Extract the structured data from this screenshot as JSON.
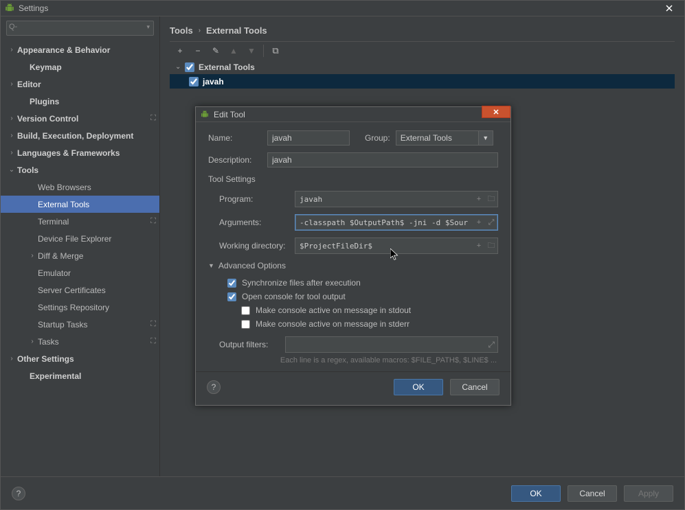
{
  "window": {
    "title": "Settings"
  },
  "search": {
    "placeholder": "",
    "prefix": "Q-"
  },
  "sidebar": {
    "items": [
      {
        "label": "Appearance & Behavior",
        "chev": "›",
        "bold": true
      },
      {
        "label": "Keymap",
        "bold": true,
        "ind": 1,
        "chev": ""
      },
      {
        "label": "Editor",
        "chev": "›",
        "bold": true
      },
      {
        "label": "Plugins",
        "bold": true,
        "ind": 1,
        "chev": ""
      },
      {
        "label": "Version Control",
        "chev": "›",
        "bold": true,
        "icon": "⛶"
      },
      {
        "label": "Build, Execution, Deployment",
        "chev": "›",
        "bold": true
      },
      {
        "label": "Languages & Frameworks",
        "chev": "›",
        "bold": true
      },
      {
        "label": "Tools",
        "chev": "⌄",
        "bold": true
      },
      {
        "label": "Web Browsers",
        "ind": 2
      },
      {
        "label": "External Tools",
        "ind": 2,
        "sel": true
      },
      {
        "label": "Terminal",
        "ind": 2,
        "icon": "⛶"
      },
      {
        "label": "Device File Explorer",
        "ind": 2
      },
      {
        "label": "Diff & Merge",
        "ind": 2,
        "chev": "›"
      },
      {
        "label": "Emulator",
        "ind": 2
      },
      {
        "label": "Server Certificates",
        "ind": 2
      },
      {
        "label": "Settings Repository",
        "ind": 2
      },
      {
        "label": "Startup Tasks",
        "ind": 2,
        "icon": "⛶"
      },
      {
        "label": "Tasks",
        "ind": 2,
        "chev": "›",
        "icon": "⛶"
      },
      {
        "label": "Other Settings",
        "chev": "›",
        "bold": true
      },
      {
        "label": "Experimental",
        "bold": true,
        "ind": 1,
        "chev": ""
      }
    ]
  },
  "breadcrumb": {
    "parent": "Tools",
    "sep": "›",
    "current": "External Tools"
  },
  "toolbar": {
    "add": "+",
    "remove": "−",
    "edit": "✎",
    "up": "▲",
    "down": "▼",
    "copy": "⧉"
  },
  "tree": {
    "root": {
      "label": "External Tools",
      "expanded": true,
      "checked": true
    },
    "child": {
      "label": "javah",
      "checked": true
    }
  },
  "dialog": {
    "title": "Edit Tool",
    "name": {
      "label": "Name:",
      "value": "javah"
    },
    "group": {
      "label": "Group:",
      "value": "External Tools"
    },
    "description": {
      "label": "Description:",
      "value": "javah"
    },
    "section_tool_settings": "Tool Settings",
    "program": {
      "label": "Program:",
      "value": "javah"
    },
    "arguments": {
      "label": "Arguments:",
      "value": "-classpath $OutputPath$ -jni -d $Source"
    },
    "workdir": {
      "label": "Working directory:",
      "value": "$ProjectFileDir$"
    },
    "advanced": {
      "label": "Advanced Options",
      "sync": {
        "label": "Synchronize files after execution",
        "checked": true
      },
      "open_console": {
        "label": "Open console for tool output",
        "checked": true
      },
      "stdout": {
        "label": "Make console active on message in stdout",
        "checked": false
      },
      "stderr": {
        "label": "Make console active on message in stderr",
        "checked": false
      }
    },
    "filters": {
      "label": "Output filters:"
    },
    "hint": "Each line is a regex, available macros: $FILE_PATH$, $LINE$ ...",
    "buttons": {
      "ok": "OK",
      "cancel": "Cancel"
    }
  },
  "footer": {
    "ok": "OK",
    "cancel": "Cancel",
    "apply": "Apply"
  }
}
